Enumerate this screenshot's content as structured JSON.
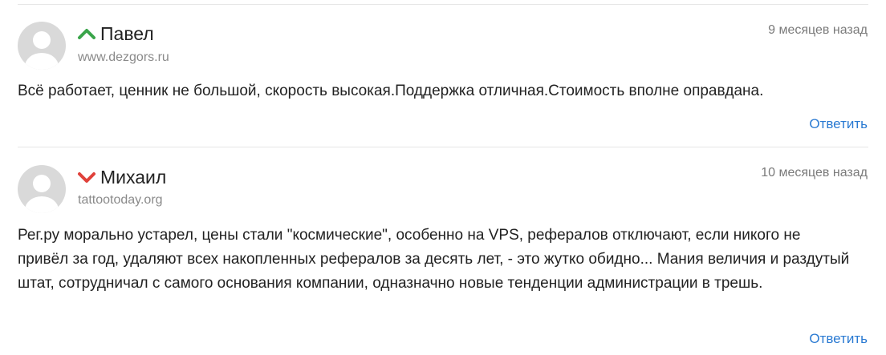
{
  "colors": {
    "upvote": "#3aa54a",
    "downvote": "#e0413a",
    "link": "#2a7ad2",
    "avatar_bg": "#d9d9d9",
    "avatar_fg": "#ffffff"
  },
  "comments": [
    {
      "author": "Павел",
      "vote_icon": "upvote-arrow-icon",
      "site": "www.dezgors.ru",
      "time": "9 месяцев назад",
      "text": "Всё работает, ценник не большой, скорость высокая.Поддержка отличная.Стоимость вполне оправдана.",
      "reply_label": "Ответить"
    },
    {
      "author": "Михаил",
      "vote_icon": "downvote-arrow-icon",
      "site": "tattootoday.org",
      "time": "10 месяцев назад",
      "text": "Рег.ру морально устарел, цены стали \"космические\", особенно на VPS, рефералов отключают, если никого не привёл за год, удаляют всех накопленных рефералов за десять лет, - это жутко обидно... Мания величия и раздутый штат, сотрудничал с самого основания компании, одназначно новые тенденции администрации в трешь.",
      "reply_label": "Ответить"
    }
  ]
}
